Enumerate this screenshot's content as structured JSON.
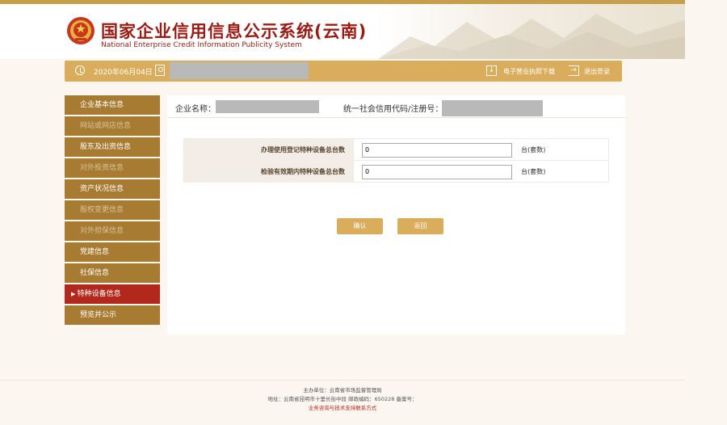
{
  "header": {
    "title_cn": "国家企业信用信息公示系统(云南)",
    "title_en": "National Enterprise Credit Information Publicity System"
  },
  "infobar": {
    "date": "2020年06月04日",
    "download_label": "电子营业执照下载",
    "logout_label": "退出登录"
  },
  "sidebar": {
    "items": [
      {
        "label": "企业基本信息"
      },
      {
        "label": "网站或网店信息"
      },
      {
        "label": "股东及出资信息"
      },
      {
        "label": "对外投资信息"
      },
      {
        "label": "资产状况信息"
      },
      {
        "label": "股权变更信息"
      },
      {
        "label": "对外担保信息"
      },
      {
        "label": "党建信息"
      },
      {
        "label": "社保信息"
      },
      {
        "label": "特种设备信息"
      },
      {
        "label": "预览并公示"
      }
    ]
  },
  "company": {
    "name_label": "企业名称：",
    "code_label": "统一社会信用代码/注册号："
  },
  "form": {
    "rows": [
      {
        "label": "办理使用登记特种设备总台数",
        "value": "0",
        "unit": "台(套数)"
      },
      {
        "label": "检验有效期内特种设备总台数",
        "value": "0",
        "unit": "台(套数)"
      }
    ]
  },
  "buttons": {
    "confirm": "确认",
    "back": "返回"
  },
  "footer": {
    "sponsor": "主办单位：云南省市场监督管理局",
    "address": "地址：云南省昆明市十里长街中段 邮政编码：650228 备案号：",
    "contact": "业务咨询与技术支持联系方式"
  },
  "colors": {
    "accent": "#d9ad5b",
    "sidebar_bg": "#a77b31",
    "active": "#b3281d",
    "title": "#9b1a12"
  }
}
